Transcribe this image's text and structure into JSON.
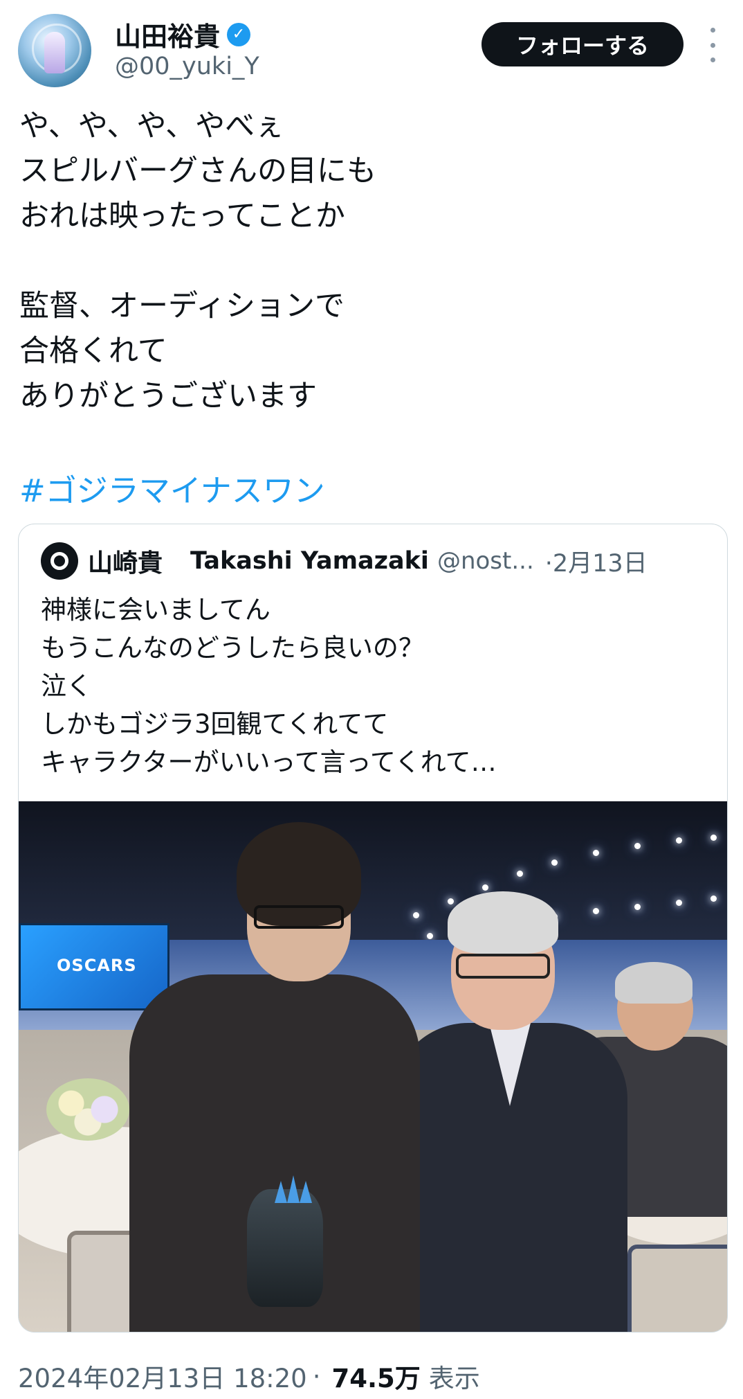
{
  "author": {
    "display_name": "山田裕貴",
    "handle": "@00_yuki_Y",
    "verified": true
  },
  "follow_label": "フォローする",
  "more_icon": "more-vertical-icon",
  "tweet": {
    "lines": [
      "や、や、や、やべぇ",
      "スピルバーグさんの目にも",
      "おれは映ったってことか",
      "",
      "監督、オーディションで",
      "合格くれて",
      "ありがとうございます"
    ],
    "hashtag": "#ゴジラマイナスワン"
  },
  "quote": {
    "name_jp": "山崎貴",
    "name_en": "Takashi Yamazaki",
    "handle": "@nost...",
    "date": "·2月13日",
    "lines": [
      "神様に会いましてん",
      "もうこんなのどうしたら良いの？",
      "泣く",
      "しかもゴジラ3回観てくれてて",
      "キャラクターがいいって言ってくれて…"
    ],
    "photo_screen_text": "OSCARS"
  },
  "footer": {
    "timestamp": "2024年02月13日 18:20",
    "separator": "·",
    "views": "74.5万",
    "views_label": "表示"
  },
  "colors": {
    "accent": "#1d9bf0",
    "text": "#0f1419",
    "muted": "#536471",
    "button_bg": "#0f1419"
  }
}
